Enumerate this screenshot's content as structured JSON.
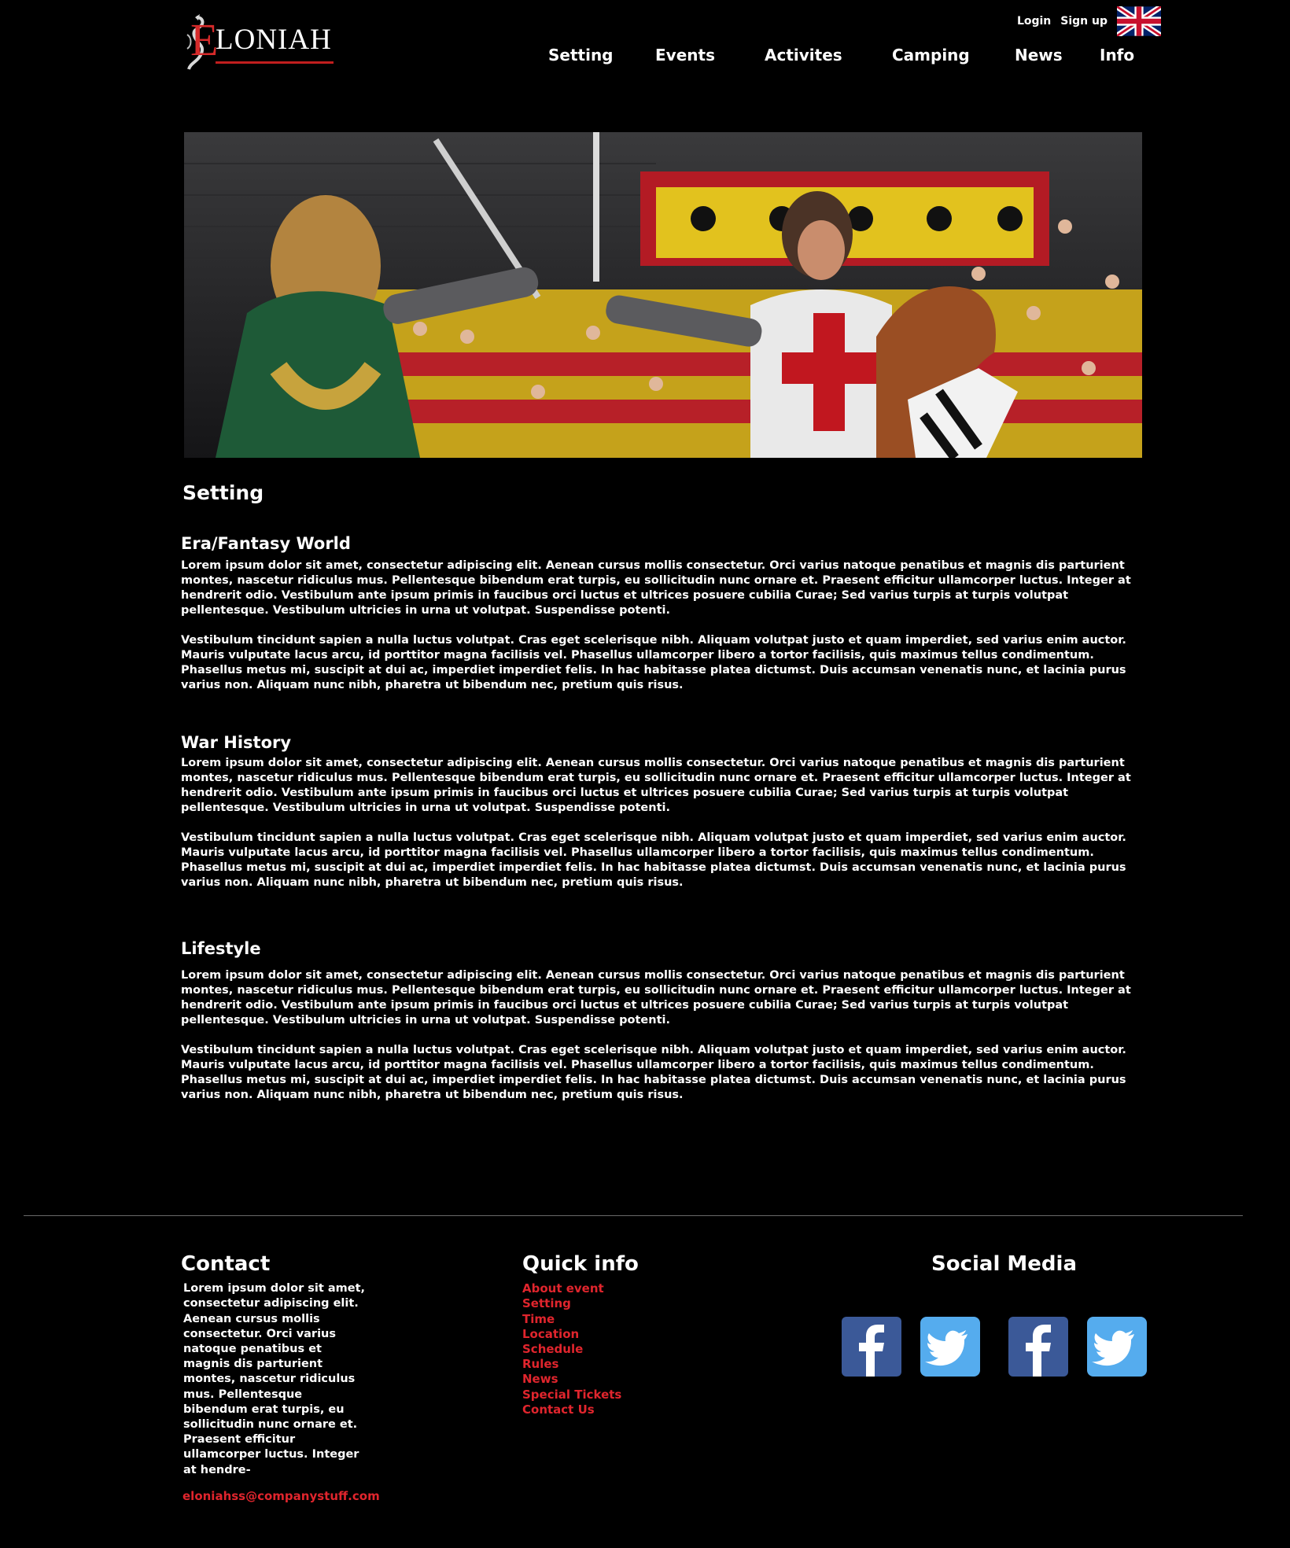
{
  "header": {
    "logo_text": "ELONIAH",
    "logo_first_letter": "E",
    "logo_rest": "LONIAH",
    "login": "Login",
    "signup": "Sign up",
    "language_flag": "uk-flag-icon"
  },
  "nav": [
    "Setting",
    "Events",
    "Activites",
    "Camping",
    "News",
    "Info"
  ],
  "hero": {
    "description": "jousting-knights-photo"
  },
  "page": {
    "title": "Setting"
  },
  "sections": [
    {
      "heading": "Era/Fantasy World",
      "p1": "Lorem ipsum dolor sit amet, consectetur adipiscing elit. Aenean cursus mollis consectetur. Orci varius natoque penatibus et magnis dis parturient montes, nascetur ridiculus mus. Pellentesque bibendum erat turpis, eu sollicitudin nunc ornare et. Praesent efficitur ullamcorper luctus. Integer at hendrerit odio. Vestibulum ante ipsum primis in faucibus orci luctus et ultrices posuere cubilia Curae; Sed varius turpis at turpis volutpat pellentesque. Vestibulum ultricies in urna ut volutpat. Suspendisse potenti.",
      "p2": "Vestibulum tincidunt sapien a nulla luctus volutpat. Cras eget scelerisque nibh. Aliquam volutpat justo et quam imperdiet, sed varius enim auctor. Mauris vulputate lacus arcu, id porttitor magna facilisis vel. Phasellus ullamcorper libero a tortor facilisis, quis maximus tellus condimentum. Phasellus metus mi, suscipit at dui ac, imperdiet imperdiet felis. In hac habitasse platea dictumst. Duis accumsan venenatis nunc, et lacinia purus varius non. Aliquam nunc nibh, pharetra ut bibendum nec, pretium quis risus."
    },
    {
      "heading": "War History",
      "p1": "Lorem ipsum dolor sit amet, consectetur adipiscing elit. Aenean cursus mollis consectetur. Orci varius natoque penatibus et magnis dis parturient montes, nascetur ridiculus mus. Pellentesque bibendum erat turpis, eu sollicitudin nunc ornare et. Praesent efficitur ullamcorper luctus. Integer at hendrerit odio. Vestibulum ante ipsum primis in faucibus orci luctus et ultrices posuere cubilia Curae; Sed varius turpis at turpis volutpat pellentesque. Vestibulum ultricies in urna ut volutpat. Suspendisse potenti.",
      "p2": "Vestibulum tincidunt sapien a nulla luctus volutpat. Cras eget scelerisque nibh. Aliquam volutpat justo et quam imperdiet, sed varius enim auctor. Mauris vulputate lacus arcu, id porttitor magna facilisis vel. Phasellus ullamcorper libero a tortor facilisis, quis maximus tellus condimentum. Phasellus metus mi, suscipit at dui ac, imperdiet imperdiet felis. In hac habitasse platea dictumst. Duis accumsan venenatis nunc, et lacinia purus varius non. Aliquam nunc nibh, pharetra ut bibendum nec, pretium quis risus."
    },
    {
      "heading": "Lifestyle",
      "p1": "Lorem ipsum dolor sit amet, consectetur adipiscing elit. Aenean cursus mollis consectetur. Orci varius natoque penatibus et magnis dis parturient montes, nascetur ridiculus mus. Pellentesque bibendum erat turpis, eu sollicitudin nunc ornare et. Praesent efficitur ullamcorper luctus. Integer at hendrerit odio. Vestibulum ante ipsum primis in faucibus orci luctus et ultrices posuere cubilia Curae; Sed varius turpis at turpis volutpat pellentesque. Vestibulum ultricies in urna ut volutpat. Suspendisse potenti.",
      "p2": "Vestibulum tincidunt sapien a nulla luctus volutpat. Cras eget scelerisque nibh. Aliquam volutpat justo et quam imperdiet, sed varius enim auctor. Mauris vulputate lacus arcu, id porttitor magna facilisis vel. Phasellus ullamcorper libero a tortor facilisis, quis maximus tellus condimentum. Phasellus metus mi, suscipit at dui ac, imperdiet imperdiet felis. In hac habitasse platea dictumst. Duis accumsan venenatis nunc, et lacinia purus varius non. Aliquam nunc nibh, pharetra ut bibendum nec, pretium quis risus."
    }
  ],
  "footer": {
    "contact": {
      "title": "Contact",
      "text": "Lorem ipsum dolor sit amet, consectetur adipiscing elit. Aenean cursus mollis consectetur. Orci varius natoque penatibus et magnis dis parturient montes, nascetur ridiculus mus. Pellentesque bibendum erat turpis, eu sollicitudin nunc ornare et. Praesent efficitur ullamcorper luctus. Integer at hendre-",
      "email": "eloniahss@companystuff.com"
    },
    "quick": {
      "title": "Quick info",
      "links": [
        "About event",
        "Setting",
        "Time",
        "Location",
        "Schedule",
        "Rules",
        "News",
        "Special Tickets",
        "Contact Us"
      ]
    },
    "social": {
      "title": "Social Media",
      "icons": [
        "facebook-icon",
        "twitter-icon",
        "facebook-icon",
        "twitter-icon"
      ]
    }
  },
  "colors": {
    "background": "#000000",
    "accent_red": "#e0252d",
    "facebook_blue": "#3b5998",
    "twitter_blue": "#55acee"
  }
}
